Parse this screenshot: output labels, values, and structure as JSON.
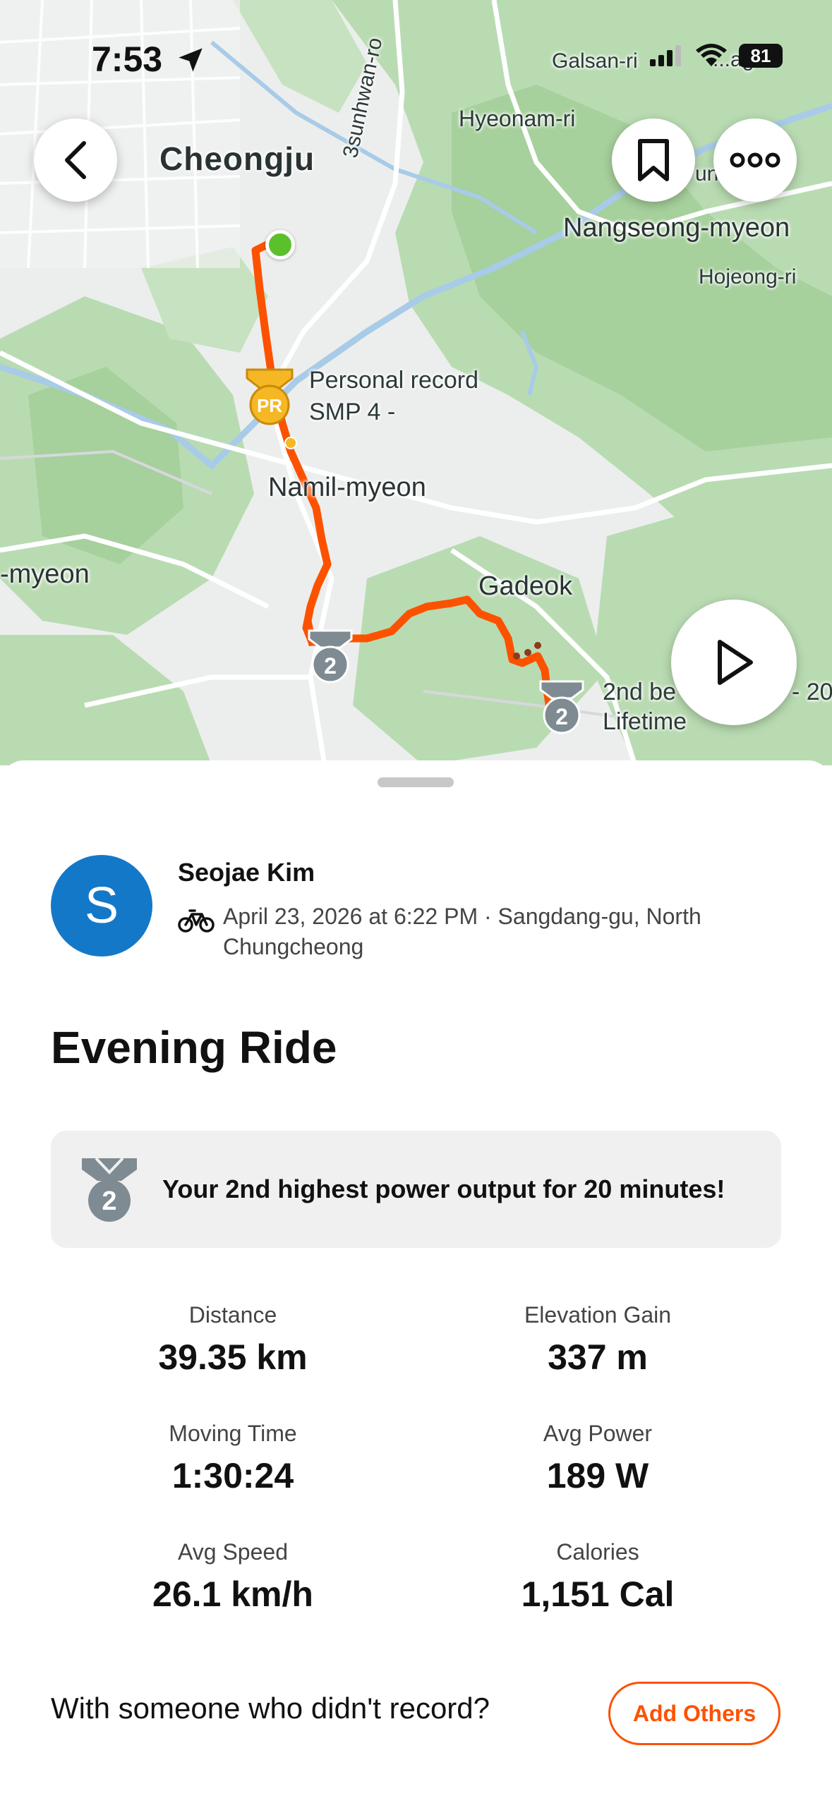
{
  "status_bar": {
    "time": "7:53",
    "battery": "81"
  },
  "map": {
    "labels": {
      "cheongju": "Cheongju",
      "hyeonam": "Hyeonam-ri",
      "road": "3sunhwan-ro",
      "galsan": "Galsan-ri",
      "unam": "...ag-ri",
      "un": "un",
      "nangseong": "Nangseong-myeon",
      "hojeong": "Hojeong-ri",
      "namil": "Namil-myeon",
      "myeon": "-myeon",
      "gadeok": "Gadeok"
    },
    "pr_callout": {
      "line1": "Personal record",
      "line2": "SMP   4 -",
      "badge": "PR"
    },
    "medal_callout": {
      "line1": "2nd be",
      "line1b": "- 20",
      "line2": "Lifetime",
      "number": "2"
    },
    "colors": {
      "route": "#fc5200",
      "start": "#5cc02c",
      "pr": "#f5b723"
    }
  },
  "activity": {
    "user_name": "Seojae Kim",
    "avatar_initial": "S",
    "meta": "April 23, 2026 at 6:22 PM · Sangdang-gu, North Chungcheong",
    "sport_icon": "bike-icon",
    "title": "Evening Ride",
    "achievement": {
      "medal": "2",
      "text": "Your 2nd highest power output for 20 minutes!"
    },
    "stats": [
      {
        "label": "Distance",
        "value": "39.35 km"
      },
      {
        "label": "Elevation Gain",
        "value": "337 m"
      },
      {
        "label": "Moving Time",
        "value": "1:30:24"
      },
      {
        "label": "Avg Power",
        "value": "189 W"
      },
      {
        "label": "Avg Speed",
        "value": "26.1 km/h"
      },
      {
        "label": "Calories",
        "value": "1,151 Cal"
      }
    ]
  },
  "footer": {
    "prompt": "With someone who didn't record?",
    "button": "Add Others"
  }
}
